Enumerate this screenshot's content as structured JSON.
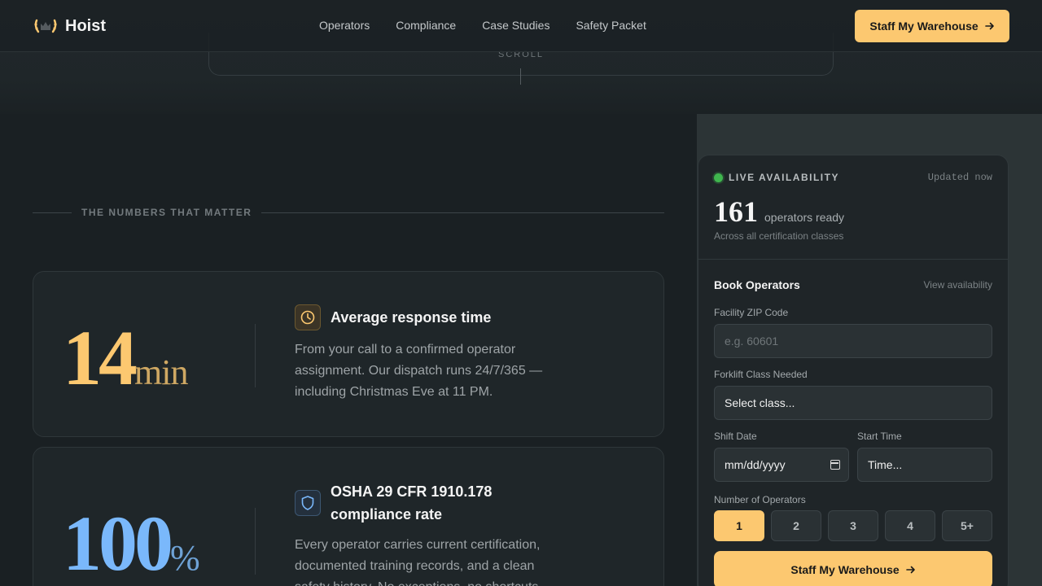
{
  "brand": {
    "name": "Hoist",
    "logo_icon": "laurel-crown-icon",
    "accent": "#fcc870"
  },
  "nav": {
    "links": [
      "Operators",
      "Compliance",
      "Case Studies",
      "Safety Packet"
    ],
    "cta_label": "Staff My Warehouse",
    "cta_icon": "arrow-right-icon"
  },
  "hero": {
    "scroll_label": "SCROLL"
  },
  "numbers": {
    "section_label": "THE NUMBERS THAT MATTER",
    "stats": [
      {
        "value": "14",
        "unit": "min",
        "color": "#fcc870",
        "icon": "clock-icon",
        "title": "Average response time",
        "desc": "From your call to a confirmed operator assignment. Our dispatch runs 24/7/365 — including Christmas Eve at 11 PM."
      },
      {
        "value": "100",
        "unit": "%",
        "color": "#7ab8fb",
        "icon": "shield-icon",
        "title": "OSHA 29 CFR 1910.178 compliance rate",
        "desc": "Every operator carries current certification, documented training records, and a clean safety history. No exceptions, no shortcuts."
      }
    ]
  },
  "booking": {
    "live_label": "LIVE AVAILABILITY",
    "live_color": "#3fb64e",
    "updated": "Updated now",
    "count": "161",
    "count_label": "operators ready",
    "count_sub": "Across all certification classes",
    "title": "Book Operators",
    "view_link": "View availability",
    "zip_label": "Facility ZIP Code",
    "zip_placeholder": "e.g. 60601",
    "class_label": "Forklift Class Needed",
    "class_value": "Select class...",
    "date_label": "Shift Date",
    "date_value": "mm/dd/yyyy",
    "time_label": "Start Time",
    "time_value": "Time...",
    "ops_label": "Number of Operators",
    "ops_options": [
      "1",
      "2",
      "3",
      "4",
      "5+"
    ],
    "ops_selected": "1",
    "cta_label": "Staff My Warehouse"
  }
}
